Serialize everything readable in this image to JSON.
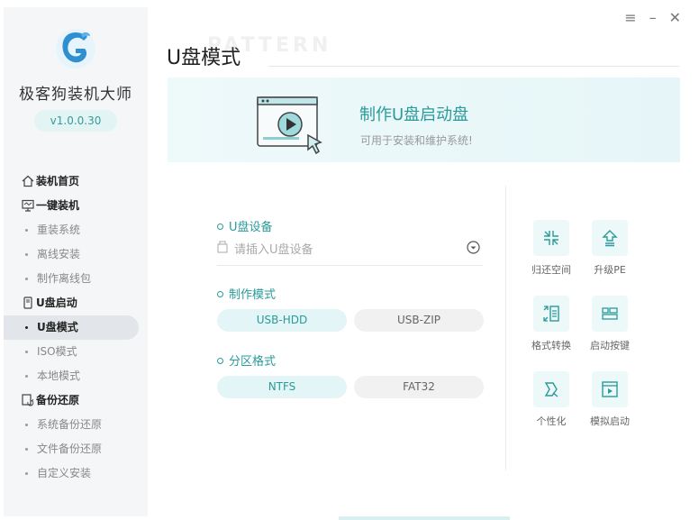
{
  "app": {
    "name": "极客狗装机大师",
    "version": "v1.0.0.30"
  },
  "window_controls": {
    "menu": "≡",
    "minimize": "–",
    "close": "✕"
  },
  "sidebar": {
    "items": [
      {
        "type": "group",
        "label": "装机首页",
        "icon": "home-icon"
      },
      {
        "type": "group",
        "label": "一键装机",
        "icon": "monitor-icon"
      },
      {
        "type": "sub",
        "label": "重装系统"
      },
      {
        "type": "sub",
        "label": "离线安装"
      },
      {
        "type": "sub",
        "label": "制作离线包"
      },
      {
        "type": "group",
        "label": "U盘启动",
        "icon": "usb-drive-icon"
      },
      {
        "type": "sub",
        "label": "U盘模式",
        "active": true
      },
      {
        "type": "sub",
        "label": "ISO模式"
      },
      {
        "type": "sub",
        "label": "本地模式"
      },
      {
        "type": "group",
        "label": "备份还原",
        "icon": "backup-icon"
      },
      {
        "type": "sub",
        "label": "系统备份还原"
      },
      {
        "type": "sub",
        "label": "文件备份还原"
      },
      {
        "type": "sub",
        "label": "自定义安装"
      }
    ]
  },
  "page": {
    "title": "U盘模式",
    "title_watermark": "PATTERN"
  },
  "banner": {
    "title": "制作U盘启动盘",
    "subtitle": "可用于安装和维护系统!"
  },
  "form": {
    "device": {
      "label": "U盘设备",
      "placeholder": "请插入U盘设备"
    },
    "mode": {
      "label": "制作模式",
      "options": [
        "USB-HDD",
        "USB-ZIP"
      ],
      "selected": "USB-HDD"
    },
    "partition": {
      "label": "分区格式",
      "options": [
        "NTFS",
        "FAT32"
      ],
      "selected": "NTFS"
    }
  },
  "tools": [
    {
      "label": "归还空间",
      "icon": "shrink-icon"
    },
    {
      "label": "升级PE",
      "icon": "upgrade-icon"
    },
    {
      "label": "格式转换",
      "icon": "convert-icon"
    },
    {
      "label": "启动按键",
      "icon": "keyboard-icon"
    },
    {
      "label": "个性化",
      "icon": "personalize-icon"
    },
    {
      "label": "模拟启动",
      "icon": "simulate-boot-icon"
    }
  ],
  "colors": {
    "accent": "#2b9a9a",
    "sidebar_bg": "#f4f6f8",
    "pill_selected": "#e3f5f6"
  }
}
